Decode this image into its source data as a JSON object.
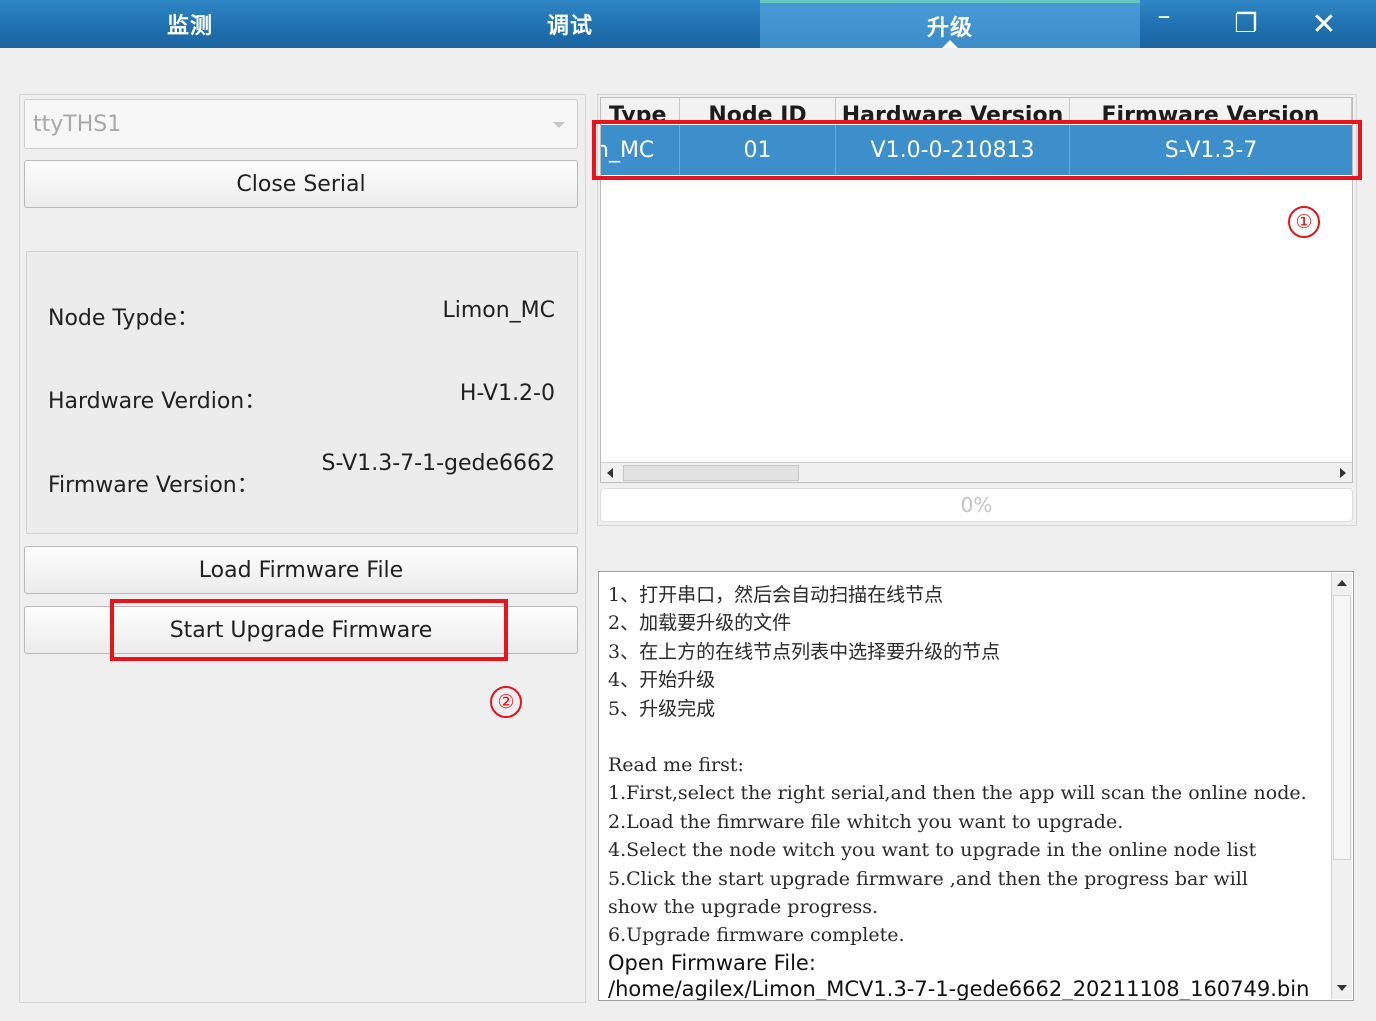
{
  "tabs": [
    {
      "label": "监测"
    },
    {
      "label": "调试"
    },
    {
      "label": "升级"
    }
  ],
  "window_controls": {
    "minimize": "–",
    "maximize": "❐",
    "close": "✕"
  },
  "serial": {
    "selected": "ttyTHS1",
    "close_label": "Close Serial"
  },
  "node_info": {
    "type_label": "Node Typde：",
    "type_value": "Limon_MC",
    "hw_label": "Hardware Verdion：",
    "hw_value": "H-V1.2-0",
    "fw_label": "Firmware Version：",
    "fw_value": "S-V1.3-7-1-gede6662"
  },
  "buttons": {
    "load_firmware": "Load Firmware File",
    "start_upgrade": "Start Upgrade Firmware"
  },
  "table": {
    "headers": [
      "Type",
      "Node ID",
      "Hardware Version",
      "Firmware Version"
    ],
    "rows": [
      {
        "type": "n_MC",
        "node_id": "01",
        "hw": "V1.0-0-210813",
        "fw": "S-V1.3-7"
      }
    ]
  },
  "progress": {
    "value": 0,
    "text": "0%"
  },
  "readme": {
    "cn_steps": [
      "1、打开串口，然后会自动扫描在线节点",
      "2、加载要升级的文件",
      "3、在上方的在线节点列表中选择要升级的节点",
      "4、开始升级",
      "5、升级完成"
    ],
    "en_title": "Read me first:",
    "en_steps": [
      "1.First,select the right serial,and then the app will scan the online node.",
      "2.Load the fimrware file whitch you want to upgrade.",
      "4.Select the node witch you want to upgrade in the online node list",
      "5.Click the start upgrade firmware ,and then the progress bar will",
      "show the upgrade progress.",
      "6.Upgrade firmware complete."
    ],
    "open_label": "Open Firmware File:",
    "file_path": "/home/agilex/Limon_MCV1.3-7-1-gede6662_20211108_160749.bin"
  },
  "annotations": {
    "marker_1": "①",
    "marker_2": "②"
  },
  "colors": {
    "accent": "#3d8fcb",
    "highlight": "#e8141b",
    "tabbar": "#1f6fae"
  }
}
